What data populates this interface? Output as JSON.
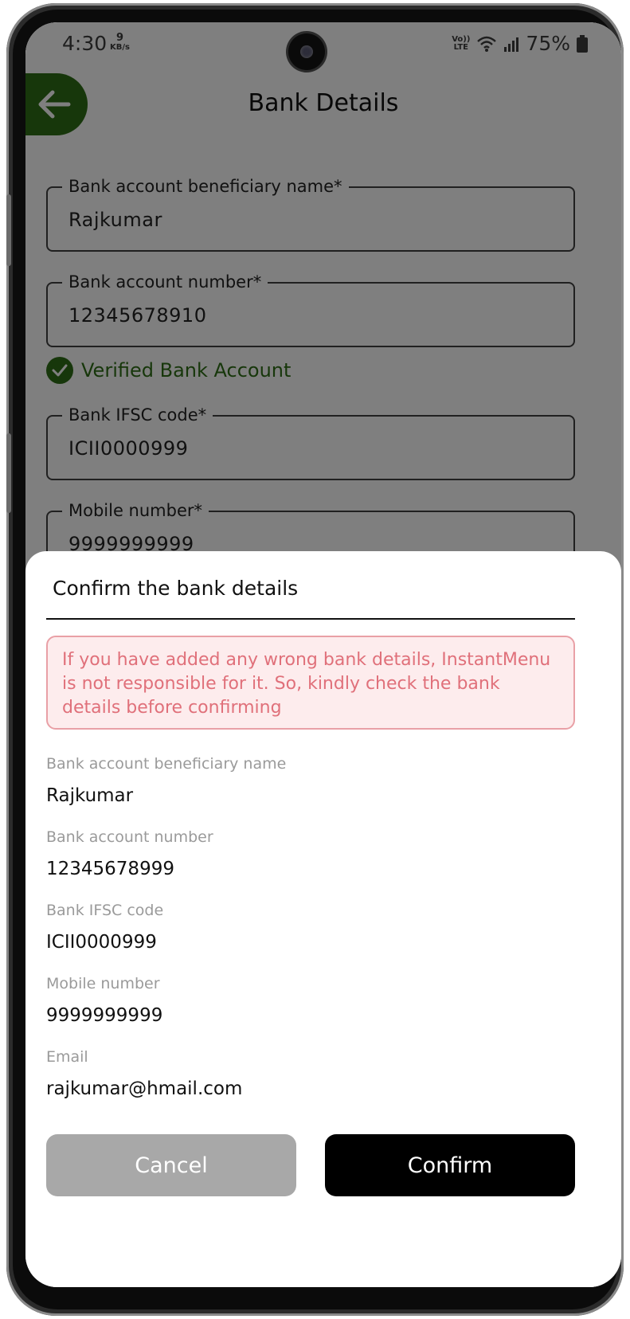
{
  "status_bar": {
    "time": "4:30",
    "net_speed_value": "9",
    "net_speed_unit": "KB/s",
    "volte": "Vo))",
    "lte": "LTE",
    "battery": "75%"
  },
  "header": {
    "title": "Bank Details"
  },
  "form": {
    "fields": [
      {
        "label": "Bank account beneficiary name*",
        "value": "Rajkumar"
      },
      {
        "label": "Bank account number*",
        "value": "12345678910"
      },
      {
        "label": "Bank IFSC code*",
        "value": "ICII0000999"
      },
      {
        "label": "Mobile number*",
        "value": "9999999999"
      }
    ],
    "verified_text": "Verified Bank Account"
  },
  "sheet": {
    "title": "Confirm the bank details",
    "warning": "If you have added any wrong bank details, InstantMenu is not responsible for it. So, kindly check the bank details before confirming",
    "details": [
      {
        "label": "Bank account beneficiary name",
        "value": "Rajkumar"
      },
      {
        "label": "Bank account number",
        "value": "12345678999"
      },
      {
        "label": "Bank IFSC code",
        "value": "ICII0000999"
      },
      {
        "label": "Mobile number",
        "value": "9999999999"
      },
      {
        "label": "Email",
        "value": "rajkumar@hmail.com"
      }
    ],
    "cancel_label": "Cancel",
    "confirm_label": "Confirm"
  },
  "colors": {
    "accent_green": "#2f6f16",
    "warning_text": "#e0707a",
    "warning_bg": "#fdeced",
    "cancel_bg": "#a8a8a8",
    "confirm_bg": "#000000"
  },
  "icons": [
    "back-arrow-icon",
    "check-circle-icon",
    "wifi-icon",
    "signal-icon",
    "battery-icon"
  ]
}
